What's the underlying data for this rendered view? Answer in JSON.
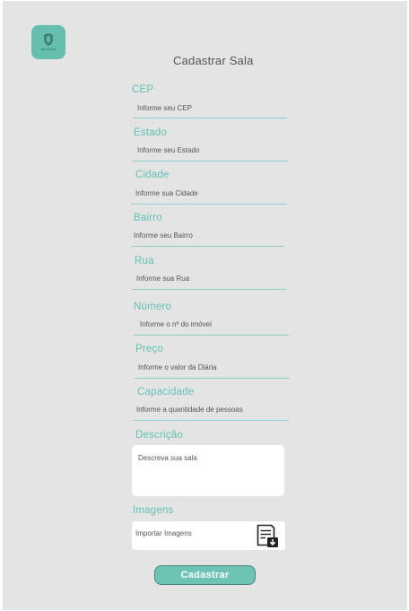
{
  "logo": {
    "icon": "shield-icon",
    "text": "BR SPACE"
  },
  "header": {
    "title": "Cadastrar Sala"
  },
  "fields": {
    "cep": {
      "label": "CEP",
      "placeholder": "Informe seu CEP"
    },
    "estado": {
      "label": "Estado",
      "placeholder": "Informe seu Estado"
    },
    "cidade": {
      "label": "Cidade",
      "placeholder": "Informe sua Cidade"
    },
    "bairro": {
      "label": "Bairro",
      "placeholder": "Informe seu Bairro"
    },
    "rua": {
      "label": "Rua",
      "placeholder": "Informe sua Rua"
    },
    "numero": {
      "label": "Número",
      "placeholder": "Informe o nº do imóvel"
    },
    "preco": {
      "label": "Preço",
      "placeholder": "Informe o valor da Diária"
    },
    "capacidade": {
      "label": "Capacidade",
      "placeholder": "Informe a quantidade de pessoas"
    },
    "descricao": {
      "label": "Descrição",
      "placeholder": "Descreva sua sala"
    },
    "imagens": {
      "label": "Imagens",
      "button_text": "Importar Imagens",
      "icon": "file-download-icon"
    }
  },
  "actions": {
    "submit_label": "Cadastrar"
  },
  "colors": {
    "accent": "#63c1b4",
    "button": "#6dc3b4",
    "background": "#e4e4e4",
    "text": "#555555"
  }
}
